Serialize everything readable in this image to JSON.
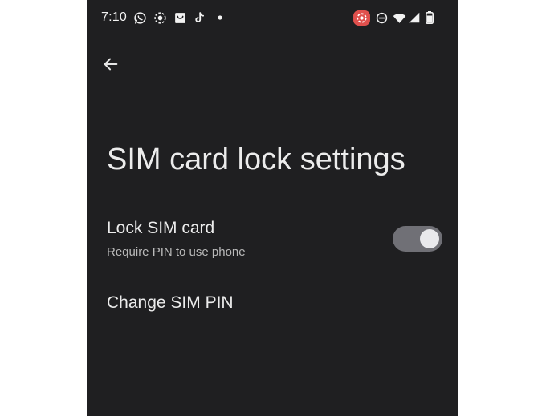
{
  "status_bar": {
    "time": "7:10",
    "left_icons": [
      "whatsapp-icon",
      "screen-record-icon",
      "shopping-bag-icon",
      "tiktok-icon",
      "notification-dot-icon"
    ],
    "right_icons": [
      "recording-badge-icon",
      "do-not-disturb-icon",
      "wifi-icon",
      "cell-signal-icon",
      "battery-icon"
    ],
    "recording_badge_color": "#e0504d"
  },
  "header": {
    "back_icon": "arrow-left-icon"
  },
  "page": {
    "title": "SIM card lock settings"
  },
  "settings": {
    "lock_sim": {
      "title": "Lock SIM card",
      "subtitle": "Require PIN to use phone",
      "enabled": false
    },
    "change_pin": {
      "title": "Change SIM PIN"
    }
  },
  "colors": {
    "background": "#1f1f21",
    "toggle_track": "#707076",
    "toggle_thumb": "#e9e9ec"
  }
}
